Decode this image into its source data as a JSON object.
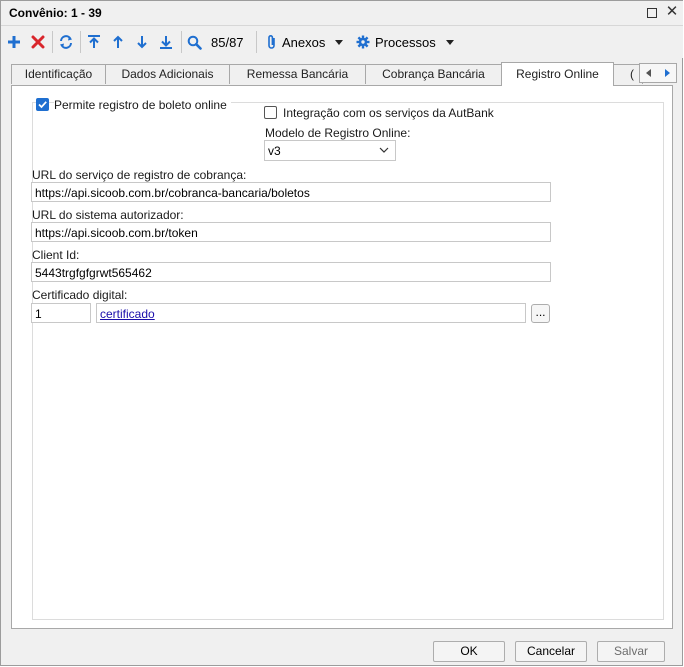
{
  "window": {
    "title": "Convênio: 1 - 39"
  },
  "toolbar": {
    "record_counter": "85/87",
    "attachments_label": "Anexos",
    "processes_label": "Processos"
  },
  "tabs": [
    {
      "label": "Identificação"
    },
    {
      "label": "Dados Adicionais"
    },
    {
      "label": "Remessa Bancária"
    },
    {
      "label": "Cobrança Bancária"
    },
    {
      "label": "Registro Online",
      "active": true
    },
    {
      "label": "("
    }
  ],
  "form": {
    "allow_online_registration": {
      "label": "Permite registro de boleto online",
      "checked": true
    },
    "autbank_integration": {
      "label": "Integração com os serviços da AutBank",
      "checked": false
    },
    "registry_model": {
      "label": "Modelo de Registro Online:",
      "value": "v3"
    },
    "registration_url": {
      "label": "URL do serviço de registro de cobrança:",
      "value": "https://api.sicoob.com.br/cobranca-bancaria/boletos"
    },
    "authorizer_url": {
      "label": "URL do sistema autorizador:",
      "value": "https://api.sicoob.com.br/token"
    },
    "client_id": {
      "label": "Client Id:",
      "value": "5443trgfgfgrwt565462"
    },
    "certificate": {
      "label": "Certificado digital:",
      "code": "1",
      "name": "certificado",
      "browse_label": "..."
    }
  },
  "footer": {
    "ok_label": "OK",
    "cancel_label": "Cancelar",
    "save_label": "Salvar"
  },
  "colors": {
    "accent_blue": "#1f6fd0",
    "delete_red": "#d9262c",
    "link": "#1a0dab"
  }
}
